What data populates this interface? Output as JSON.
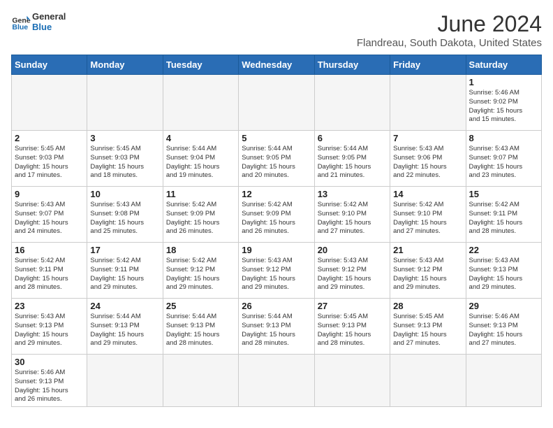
{
  "logo": {
    "text_general": "General",
    "text_blue": "Blue"
  },
  "header": {
    "title": "June 2024",
    "subtitle": "Flandreau, South Dakota, United States"
  },
  "weekdays": [
    "Sunday",
    "Monday",
    "Tuesday",
    "Wednesday",
    "Thursday",
    "Friday",
    "Saturday"
  ],
  "weeks": [
    [
      {
        "day": "",
        "info": ""
      },
      {
        "day": "",
        "info": ""
      },
      {
        "day": "",
        "info": ""
      },
      {
        "day": "",
        "info": ""
      },
      {
        "day": "",
        "info": ""
      },
      {
        "day": "",
        "info": ""
      },
      {
        "day": "1",
        "info": "Sunrise: 5:46 AM\nSunset: 9:02 PM\nDaylight: 15 hours\nand 15 minutes."
      }
    ],
    [
      {
        "day": "2",
        "info": "Sunrise: 5:45 AM\nSunset: 9:03 PM\nDaylight: 15 hours\nand 17 minutes."
      },
      {
        "day": "3",
        "info": "Sunrise: 5:45 AM\nSunset: 9:03 PM\nDaylight: 15 hours\nand 18 minutes."
      },
      {
        "day": "4",
        "info": "Sunrise: 5:44 AM\nSunset: 9:04 PM\nDaylight: 15 hours\nand 19 minutes."
      },
      {
        "day": "5",
        "info": "Sunrise: 5:44 AM\nSunset: 9:05 PM\nDaylight: 15 hours\nand 20 minutes."
      },
      {
        "day": "6",
        "info": "Sunrise: 5:44 AM\nSunset: 9:05 PM\nDaylight: 15 hours\nand 21 minutes."
      },
      {
        "day": "7",
        "info": "Sunrise: 5:43 AM\nSunset: 9:06 PM\nDaylight: 15 hours\nand 22 minutes."
      },
      {
        "day": "8",
        "info": "Sunrise: 5:43 AM\nSunset: 9:07 PM\nDaylight: 15 hours\nand 23 minutes."
      }
    ],
    [
      {
        "day": "9",
        "info": "Sunrise: 5:43 AM\nSunset: 9:07 PM\nDaylight: 15 hours\nand 24 minutes."
      },
      {
        "day": "10",
        "info": "Sunrise: 5:43 AM\nSunset: 9:08 PM\nDaylight: 15 hours\nand 25 minutes."
      },
      {
        "day": "11",
        "info": "Sunrise: 5:42 AM\nSunset: 9:09 PM\nDaylight: 15 hours\nand 26 minutes."
      },
      {
        "day": "12",
        "info": "Sunrise: 5:42 AM\nSunset: 9:09 PM\nDaylight: 15 hours\nand 26 minutes."
      },
      {
        "day": "13",
        "info": "Sunrise: 5:42 AM\nSunset: 9:10 PM\nDaylight: 15 hours\nand 27 minutes."
      },
      {
        "day": "14",
        "info": "Sunrise: 5:42 AM\nSunset: 9:10 PM\nDaylight: 15 hours\nand 27 minutes."
      },
      {
        "day": "15",
        "info": "Sunrise: 5:42 AM\nSunset: 9:11 PM\nDaylight: 15 hours\nand 28 minutes."
      }
    ],
    [
      {
        "day": "16",
        "info": "Sunrise: 5:42 AM\nSunset: 9:11 PM\nDaylight: 15 hours\nand 28 minutes."
      },
      {
        "day": "17",
        "info": "Sunrise: 5:42 AM\nSunset: 9:11 PM\nDaylight: 15 hours\nand 29 minutes."
      },
      {
        "day": "18",
        "info": "Sunrise: 5:42 AM\nSunset: 9:12 PM\nDaylight: 15 hours\nand 29 minutes."
      },
      {
        "day": "19",
        "info": "Sunrise: 5:43 AM\nSunset: 9:12 PM\nDaylight: 15 hours\nand 29 minutes."
      },
      {
        "day": "20",
        "info": "Sunrise: 5:43 AM\nSunset: 9:12 PM\nDaylight: 15 hours\nand 29 minutes."
      },
      {
        "day": "21",
        "info": "Sunrise: 5:43 AM\nSunset: 9:12 PM\nDaylight: 15 hours\nand 29 minutes."
      },
      {
        "day": "22",
        "info": "Sunrise: 5:43 AM\nSunset: 9:13 PM\nDaylight: 15 hours\nand 29 minutes."
      }
    ],
    [
      {
        "day": "23",
        "info": "Sunrise: 5:43 AM\nSunset: 9:13 PM\nDaylight: 15 hours\nand 29 minutes."
      },
      {
        "day": "24",
        "info": "Sunrise: 5:44 AM\nSunset: 9:13 PM\nDaylight: 15 hours\nand 29 minutes."
      },
      {
        "day": "25",
        "info": "Sunrise: 5:44 AM\nSunset: 9:13 PM\nDaylight: 15 hours\nand 28 minutes."
      },
      {
        "day": "26",
        "info": "Sunrise: 5:44 AM\nSunset: 9:13 PM\nDaylight: 15 hours\nand 28 minutes."
      },
      {
        "day": "27",
        "info": "Sunrise: 5:45 AM\nSunset: 9:13 PM\nDaylight: 15 hours\nand 28 minutes."
      },
      {
        "day": "28",
        "info": "Sunrise: 5:45 AM\nSunset: 9:13 PM\nDaylight: 15 hours\nand 27 minutes."
      },
      {
        "day": "29",
        "info": "Sunrise: 5:46 AM\nSunset: 9:13 PM\nDaylight: 15 hours\nand 27 minutes."
      }
    ],
    [
      {
        "day": "30",
        "info": "Sunrise: 5:46 AM\nSunset: 9:13 PM\nDaylight: 15 hours\nand 26 minutes."
      },
      {
        "day": "",
        "info": ""
      },
      {
        "day": "",
        "info": ""
      },
      {
        "day": "",
        "info": ""
      },
      {
        "day": "",
        "info": ""
      },
      {
        "day": "",
        "info": ""
      },
      {
        "day": "",
        "info": ""
      }
    ]
  ]
}
